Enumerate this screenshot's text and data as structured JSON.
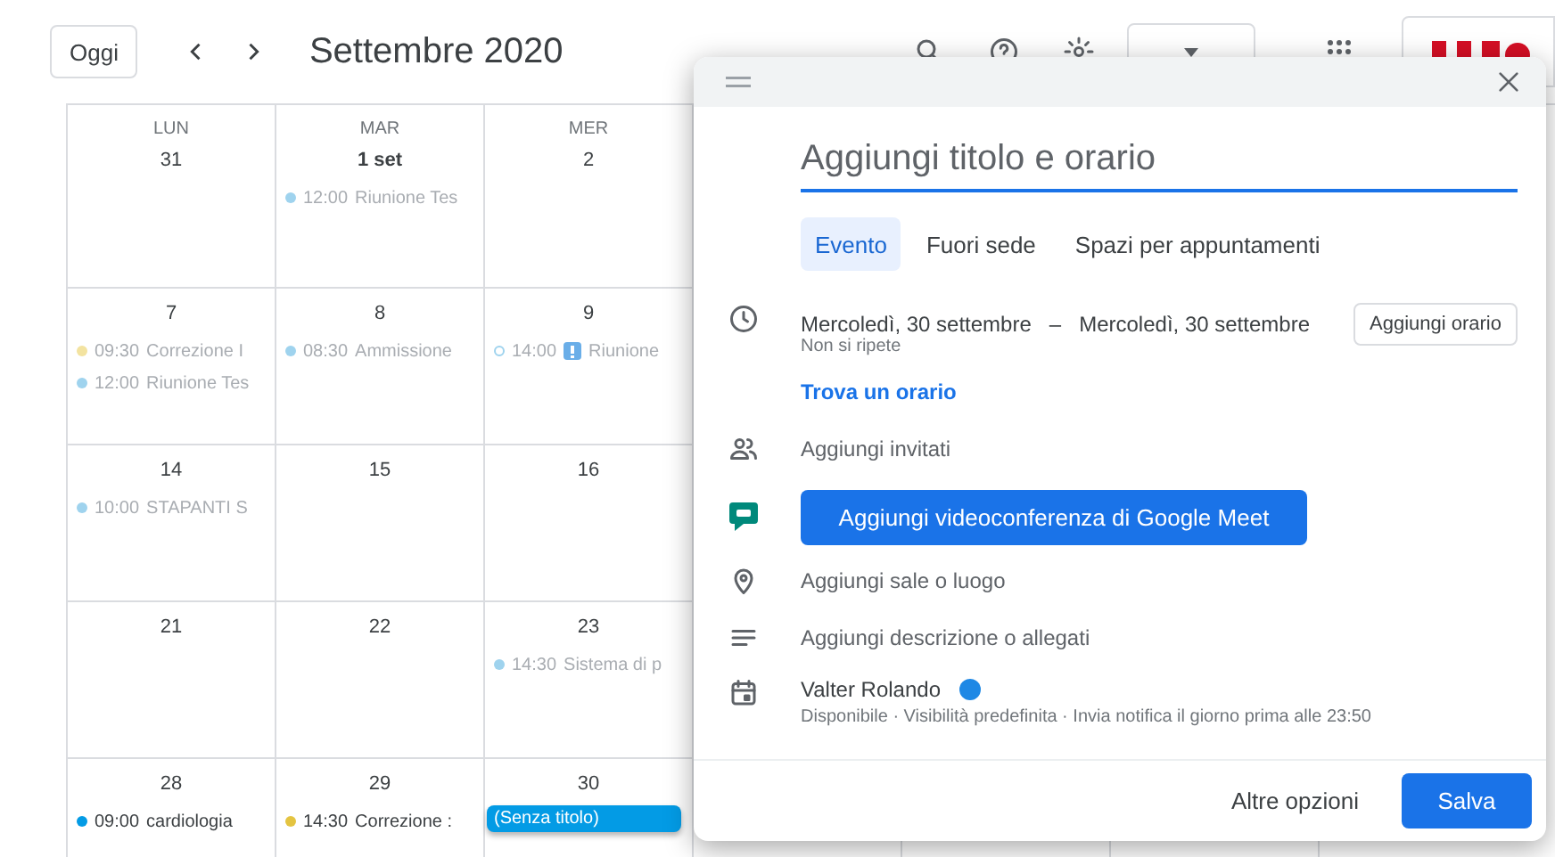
{
  "toolbar": {
    "today_button": "Oggi",
    "title": "Settembre 2020"
  },
  "calendar": {
    "weeks": [
      {
        "days": [
          {
            "weekday": "LUN",
            "date": "31"
          },
          {
            "weekday": "MAR",
            "date": "1 set",
            "events": [
              {
                "kind": "dot",
                "color": "#9fd3ee",
                "past": true,
                "time": "12:00",
                "title": "Riunione Tes"
              }
            ]
          },
          {
            "weekday": "MER",
            "date": "2"
          }
        ]
      },
      {
        "days": [
          {
            "date": "7",
            "events": [
              {
                "kind": "dot",
                "color": "#f3e3a0",
                "past": true,
                "time": "09:30",
                "title": "Correzione I"
              },
              {
                "kind": "dot",
                "color": "#9fd3ee",
                "past": true,
                "time": "12:00",
                "title": "Riunione Tes"
              }
            ]
          },
          {
            "date": "8",
            "events": [
              {
                "kind": "dot",
                "color": "#9fd3ee",
                "past": true,
                "time": "08:30",
                "title": "Ammissione"
              }
            ]
          },
          {
            "date": "9",
            "events": [
              {
                "kind": "ring",
                "color": "#9fd3ee",
                "past": true,
                "alert": true,
                "time": "14:00",
                "title": "Riunione"
              }
            ]
          }
        ]
      },
      {
        "days": [
          {
            "date": "14",
            "events": [
              {
                "kind": "dot",
                "color": "#9fd3ee",
                "past": true,
                "time": "10:00",
                "title": "STAPANTI S"
              }
            ]
          },
          {
            "date": "15"
          },
          {
            "date": "16"
          }
        ]
      },
      {
        "days": [
          {
            "date": "21"
          },
          {
            "date": "22"
          },
          {
            "date": "23",
            "events": [
              {
                "kind": "dot",
                "color": "#9fd3ee",
                "past": true,
                "time": "14:30",
                "title": "Sistema di p"
              }
            ]
          }
        ]
      },
      {
        "days": [
          {
            "date": "28",
            "events": [
              {
                "kind": "dot",
                "color": "#039be5",
                "past": false,
                "time": "09:00",
                "title": "cardiologia"
              }
            ]
          },
          {
            "date": "29",
            "events": [
              {
                "kind": "dot",
                "color": "#e4c441",
                "past": false,
                "time": "14:30",
                "title": "Correzione :"
              }
            ]
          },
          {
            "date": "30",
            "events": [
              {
                "kind": "chip",
                "color": "#039be5",
                "title": "(Senza titolo)"
              }
            ]
          }
        ]
      }
    ]
  },
  "dialog": {
    "title_field": {
      "placeholder": "Aggiungi titolo e orario"
    },
    "tabs": [
      {
        "label": "Evento",
        "selected": true
      },
      {
        "label": "Fuori sede",
        "selected": false
      },
      {
        "label": "Spazi per appuntamenti",
        "selected": false
      }
    ],
    "date_range": {
      "start": "Mercoledì, 30 settembre",
      "separator": "–",
      "end": "Mercoledì, 30 settembre",
      "repeat": "Non si ripete",
      "add_time_button": "Aggiungi orario"
    },
    "find_time_link": "Trova un orario",
    "guests": "Aggiungi invitati",
    "meet_button": "Aggiungi videoconferenza di Google Meet",
    "location": "Aggiungi sale o luogo",
    "description": "Aggiungi descrizione o allegati",
    "calendar": {
      "owner": "Valter Rolando",
      "color": "#1e88e5",
      "details": "Disponibile · Visibilità predefinita · Invia notifica il giorno prima alle 23:50"
    },
    "footer": {
      "more_options": "Altre opzioni",
      "save": "Salva"
    }
  }
}
